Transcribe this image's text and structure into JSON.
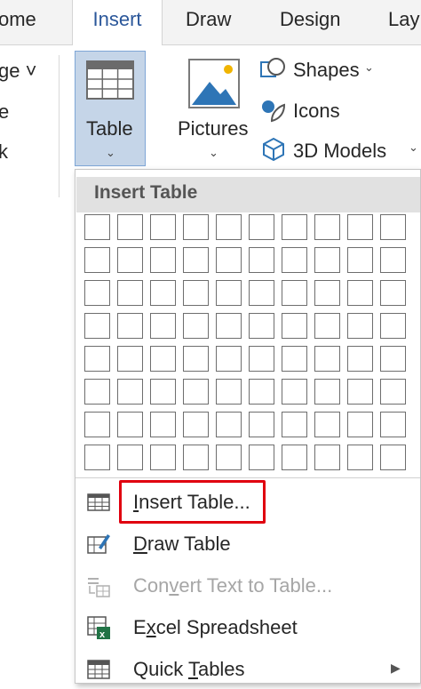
{
  "tabs": [
    {
      "label": "ome"
    },
    {
      "label": "Insert"
    },
    {
      "label": "Draw"
    },
    {
      "label": "Design"
    },
    {
      "label": "Lay"
    }
  ],
  "ribbon": {
    "left_items": [
      "ge ˅",
      "e",
      "k"
    ],
    "table_label": "Table",
    "pictures_label": "Pictures",
    "shapes_label": "Shapes",
    "icons_label": "Icons",
    "models_label": "3D Models"
  },
  "dropdown": {
    "header": "Insert Table",
    "grid": {
      "columns": 10,
      "rows": 8
    },
    "items": [
      {
        "label": "Insert Table...",
        "enabled": true
      },
      {
        "label": "Draw Table",
        "enabled": true
      },
      {
        "label": "Convert Text to Table...",
        "enabled": false
      },
      {
        "label": "Excel Spreadsheet",
        "enabled": true
      },
      {
        "label": "Quick Tables",
        "enabled": true
      }
    ]
  },
  "colors": {
    "accent": "#2b579a",
    "selected_button": "#c5d5e8",
    "highlight_border": "#e0000f",
    "excel_green": "#217346"
  }
}
